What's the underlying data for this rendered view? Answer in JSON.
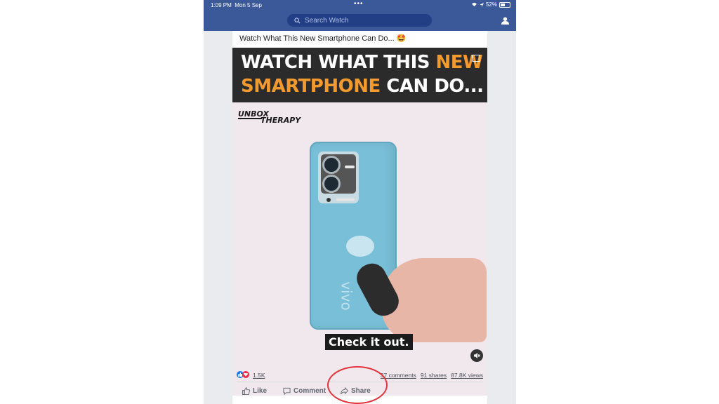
{
  "status": {
    "time": "1:09 PM",
    "date": "Mon 5 Sep",
    "battery": "52%",
    "battery_level": 0.52,
    "dots": "•••"
  },
  "search": {
    "placeholder": "Search Watch"
  },
  "post": {
    "title": "Watch What This New Smartphone Can Do... 🤩",
    "banner_line1_a": "WATCH WHAT THIS ",
    "banner_line1_b": "NEW",
    "banner_line2_a": "SMARTPHONE",
    "banner_line2_b": " CAN DO...",
    "channel_logo_1": "UNBOX",
    "channel_logo_2": "THERAPY",
    "phone_brand": "vivo",
    "caption": "Check it out.",
    "reactions_count": "1.5K",
    "comments": "37 comments",
    "shares": "91 shares",
    "views": "87.8K views"
  },
  "actions": {
    "like": "Like",
    "comment": "Comment",
    "share": "Share"
  },
  "colors": {
    "header": "#3b5998",
    "accent_orange": "#f39a2e",
    "annotation_red": "#e2333a"
  }
}
